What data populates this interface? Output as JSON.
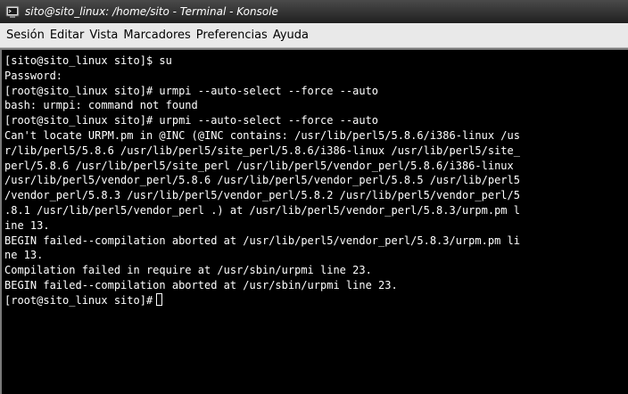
{
  "window": {
    "title": "sito@sito_linux: /home/sito - Terminal - Konsole"
  },
  "menubar": {
    "items": [
      "Sesión",
      "Editar",
      "Vista",
      "Marcadores",
      "Preferencias",
      "Ayuda"
    ]
  },
  "terminal": {
    "lines": [
      "[sito@sito_linux sito]$ su",
      "Password:",
      "[root@sito_linux sito]# urmpi --auto-select --force --auto",
      "bash: urmpi: command not found",
      "[root@sito_linux sito]# urpmi --auto-select --force --auto",
      "Can't locate URPM.pm in @INC (@INC contains: /usr/lib/perl5/5.8.6/i386-linux /us",
      "r/lib/perl5/5.8.6 /usr/lib/perl5/site_perl/5.8.6/i386-linux /usr/lib/perl5/site_",
      "perl/5.8.6 /usr/lib/perl5/site_perl /usr/lib/perl5/vendor_perl/5.8.6/i386-linux",
      "/usr/lib/perl5/vendor_perl/5.8.6 /usr/lib/perl5/vendor_perl/5.8.5 /usr/lib/perl5",
      "/vendor_perl/5.8.3 /usr/lib/perl5/vendor_perl/5.8.2 /usr/lib/perl5/vendor_perl/5",
      ".8.1 /usr/lib/perl5/vendor_perl .) at /usr/lib/perl5/vendor_perl/5.8.3/urpm.pm l",
      "ine 13.",
      "BEGIN failed--compilation aborted at /usr/lib/perl5/vendor_perl/5.8.3/urpm.pm li",
      "ne 13.",
      "Compilation failed in require at /usr/sbin/urpmi line 23.",
      "BEGIN failed--compilation aborted at /usr/sbin/urpmi line 23."
    ],
    "prompt": "[root@sito_linux sito]#"
  },
  "colors": {
    "background": "#000000",
    "foreground": "#ffffff",
    "menubar": "#e9e9e9"
  },
  "icons": {
    "window_icon": "konsole-terminal-icon"
  }
}
